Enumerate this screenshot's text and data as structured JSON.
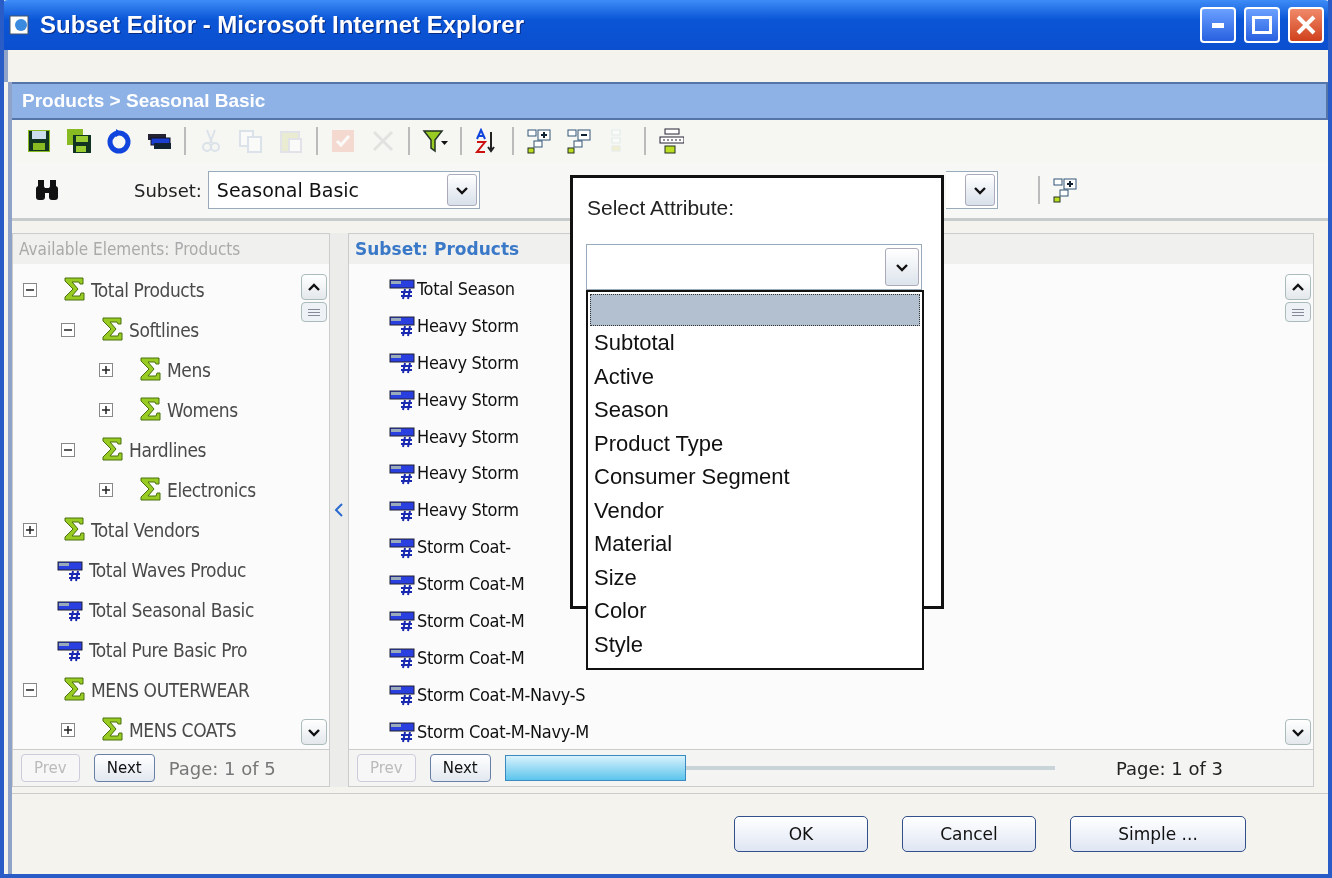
{
  "window": {
    "title": "Subset Editor - Microsoft Internet Explorer"
  },
  "breadcrumb": "Products > Seasonal Basic",
  "toolbar": {
    "groups": [
      [
        {
          "kind": "save",
          "disabled": false
        },
        {
          "kind": "save-all",
          "disabled": false
        },
        {
          "kind": "refresh",
          "disabled": false
        },
        {
          "kind": "stack",
          "disabled": false
        }
      ],
      [
        {
          "kind": "cut",
          "disabled": true
        },
        {
          "kind": "copy",
          "disabled": true
        },
        {
          "kind": "paste",
          "disabled": true
        }
      ],
      [
        {
          "kind": "check",
          "disabled": true
        },
        {
          "kind": "delete",
          "disabled": true
        }
      ],
      [
        {
          "kind": "filter",
          "disabled": false
        }
      ],
      [
        {
          "kind": "sort",
          "disabled": false
        }
      ],
      [
        {
          "kind": "expand",
          "disabled": false
        },
        {
          "kind": "collapse",
          "disabled": false
        },
        {
          "kind": "level",
          "disabled": true
        }
      ],
      [
        {
          "kind": "hierarchy",
          "disabled": false
        }
      ]
    ]
  },
  "subset": {
    "label": "Subset:",
    "value": "Seasonal Basic"
  },
  "available": {
    "heading": "Available Elements: Products",
    "tree": [
      {
        "label": "Total Products",
        "kind": "consolidated",
        "expanded": true,
        "children": [
          {
            "label": "Softlines",
            "kind": "consolidated",
            "expanded": true,
            "children": [
              {
                "label": "Mens",
                "kind": "consolidated",
                "expanded": false
              },
              {
                "label": "Womens",
                "kind": "consolidated",
                "expanded": false
              }
            ]
          },
          {
            "label": "Hardlines",
            "kind": "consolidated",
            "expanded": true,
            "children": [
              {
                "label": "Electronics",
                "kind": "consolidated",
                "expanded": false
              }
            ]
          }
        ]
      },
      {
        "label": "Total Vendors",
        "kind": "consolidated",
        "expanded": false
      },
      {
        "label": "Total Waves Produc",
        "kind": "leaf"
      },
      {
        "label": "Total Seasonal Basic",
        "kind": "leaf"
      },
      {
        "label": "Total Pure Basic Pro",
        "kind": "leaf"
      },
      {
        "label": "MENS OUTERWEAR",
        "kind": "consolidated",
        "expanded": true,
        "children": [
          {
            "label": "MENS COATS",
            "kind": "consolidated",
            "expanded": false
          }
        ]
      }
    ],
    "pager": {
      "prev": {
        "label": "Prev",
        "disabled": true
      },
      "next": {
        "label": "Next",
        "disabled": false
      },
      "page": "Page: 1 of 5"
    }
  },
  "subset_list": {
    "heading": "Subset: Products",
    "items": [
      "Total Season",
      "Heavy Storm",
      "Heavy Storm",
      "Heavy Storm",
      "Heavy Storm",
      "Heavy Storm",
      "Heavy Storm",
      "Storm Coat-",
      "Storm Coat-M",
      "Storm Coat-M",
      "Storm Coat-M",
      "Storm Coat-M-Navy-S",
      "Storm Coat-M-Navy-M"
    ],
    "pager": {
      "prev": {
        "label": "Prev",
        "disabled": true
      },
      "next": {
        "label": "Next",
        "disabled": false
      },
      "level": 0.33,
      "page": "Page: 1 of 3"
    }
  },
  "attribute_popup": {
    "label": "Select Attribute:",
    "blank_option": {
      "selected": true
    },
    "options": [
      {
        "label": "Subtotal",
        "selected": false
      },
      {
        "label": "Active",
        "selected": false
      },
      {
        "label": "Season",
        "selected": false
      },
      {
        "label": "Product Type",
        "selected": false
      },
      {
        "label": "Consumer Segment",
        "selected": false
      },
      {
        "label": "Vendor",
        "selected": false
      },
      {
        "label": "Material",
        "selected": false
      },
      {
        "label": "Size",
        "selected": false
      },
      {
        "label": "Color",
        "selected": false
      },
      {
        "label": "Style",
        "selected": false
      }
    ]
  },
  "buttons": [
    "OK",
    "Cancel",
    "Simple ..."
  ]
}
